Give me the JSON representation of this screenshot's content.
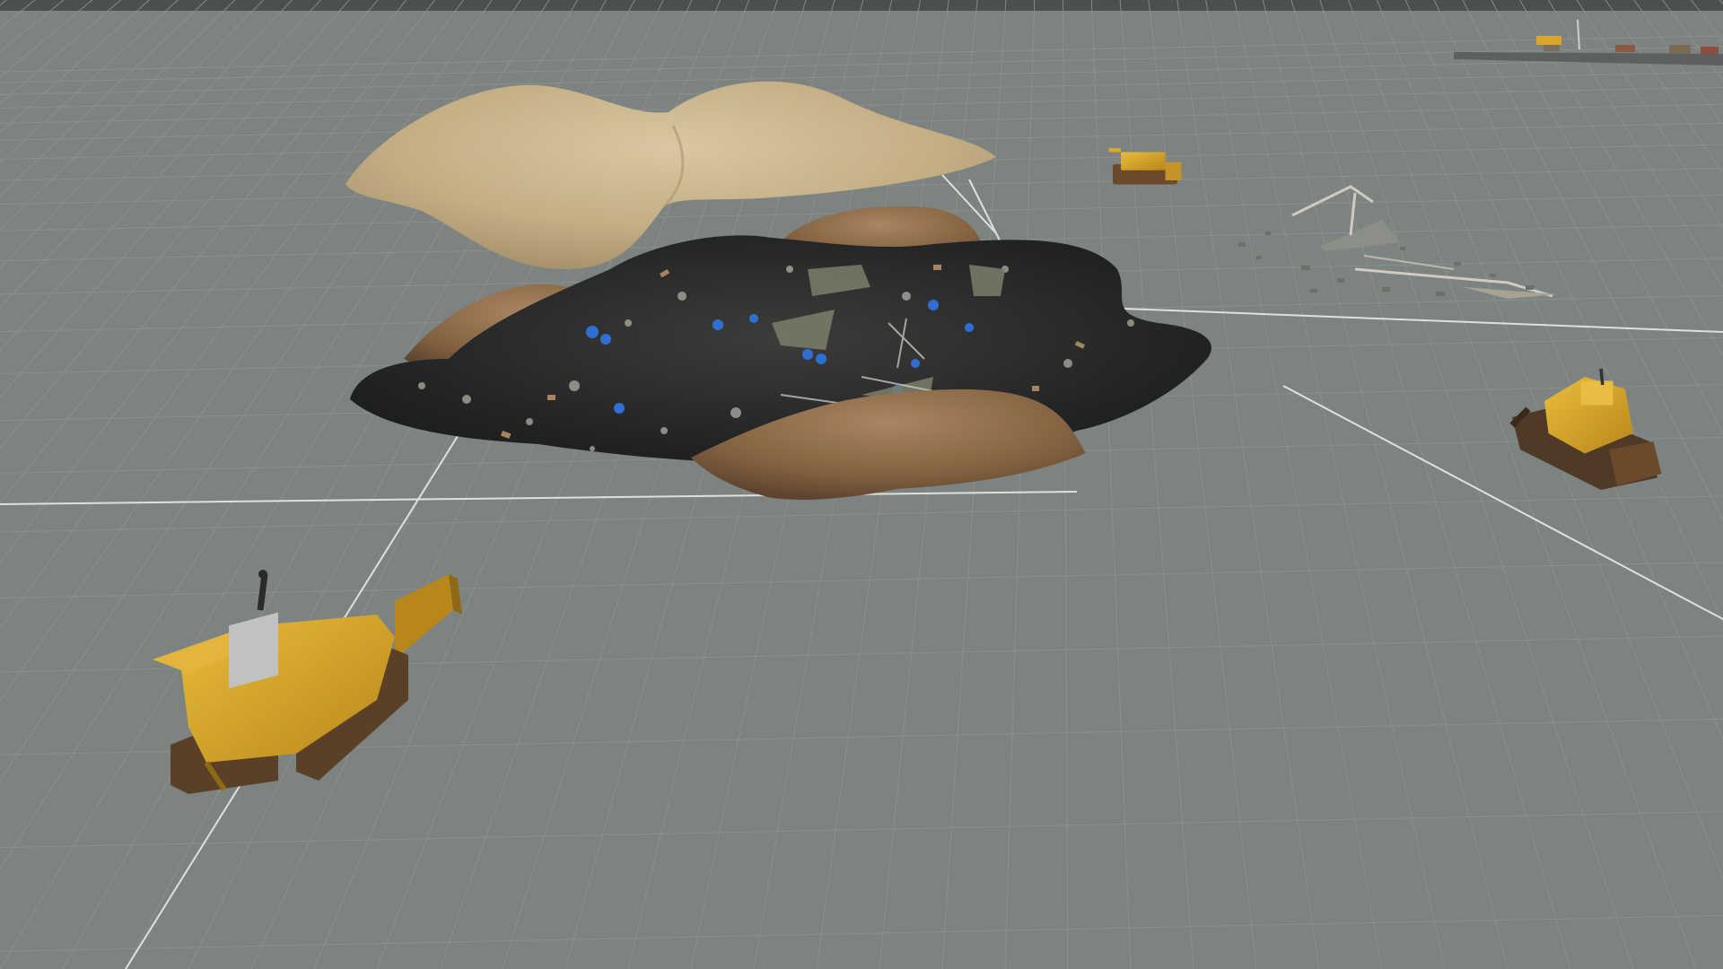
{
  "app": {
    "title": ""
  },
  "viewport": {
    "background": "#7d8381",
    "grid_color": "#8c9290",
    "axis_color": "#e8ecea",
    "top_bar_color": "#4b4f4e"
  },
  "scene_objects": [
    {
      "name": "sand-pile",
      "color": "#c7b38d"
    },
    {
      "name": "dirt-mound",
      "color": "#8a6745"
    },
    {
      "name": "landfill-trash-heap",
      "color": "#2a2b2c"
    },
    {
      "name": "bulldozer",
      "color": "#d9a52b",
      "count": 4
    },
    {
      "name": "debris-wreckage",
      "color": "#8b8f88"
    },
    {
      "name": "distant-landfill-prefab",
      "color": "#5d5f60"
    }
  ]
}
